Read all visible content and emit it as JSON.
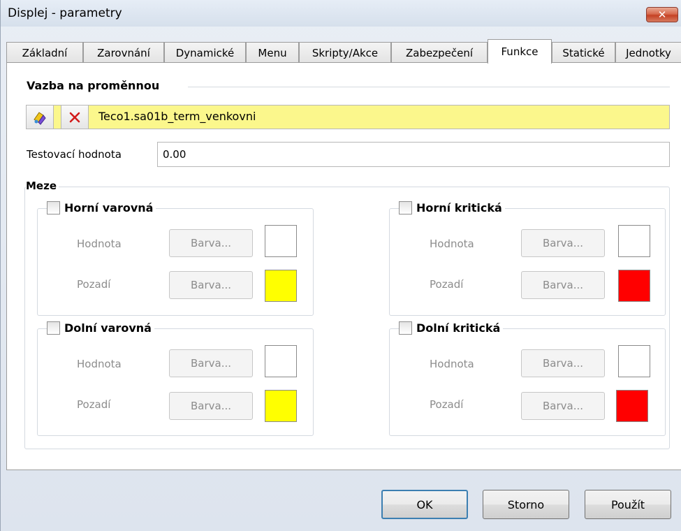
{
  "window": {
    "title": "Displej - parametry",
    "close_glyph": "✕"
  },
  "tabs": [
    {
      "label": "Základní"
    },
    {
      "label": "Zarovnání"
    },
    {
      "label": "Dynamické"
    },
    {
      "label": "Menu"
    },
    {
      "label": "Skripty/Akce"
    },
    {
      "label": "Zabezpečení"
    },
    {
      "label": "Funkce",
      "active": true
    },
    {
      "label": "Statické"
    },
    {
      "label": "Jednotky"
    }
  ],
  "binding": {
    "section_title": "Vazba na proměnnou",
    "variable": "Teco1.sa01b_term_venkovni",
    "bar_color": "#fbf78c"
  },
  "test_value": {
    "label": "Testovací hodnota",
    "value": "0.00"
  },
  "limits": {
    "title": "Meze",
    "groups": [
      {
        "label": "Horní varovná",
        "value_label": "Hodnota",
        "bg_label": "Pozadí",
        "button_label": "Barva...",
        "value_color": "#ffffff",
        "bg_color": "#ffff00"
      },
      {
        "label": "Horní kritická",
        "value_label": "Hodnota",
        "bg_label": "Pozadí",
        "button_label": "Barva...",
        "value_color": "#ffffff",
        "bg_color": "#ff0000"
      },
      {
        "label": "Dolní varovná",
        "value_label": "Hodnota",
        "bg_label": "Pozadí",
        "button_label": "Barva...",
        "value_color": "#ffffff",
        "bg_color": "#ffff00"
      },
      {
        "label": "Dolní kritická",
        "value_label": "Hodnota",
        "bg_label": "Pozadí",
        "button_label": "Barva...",
        "value_color": "#ffffff",
        "bg_color": "#ff0000"
      }
    ]
  },
  "footer": {
    "ok": "OK",
    "cancel": "Storno",
    "apply": "Použít"
  },
  "icons": {
    "binding": "link-variable-icon",
    "remove": "close-x-icon"
  }
}
